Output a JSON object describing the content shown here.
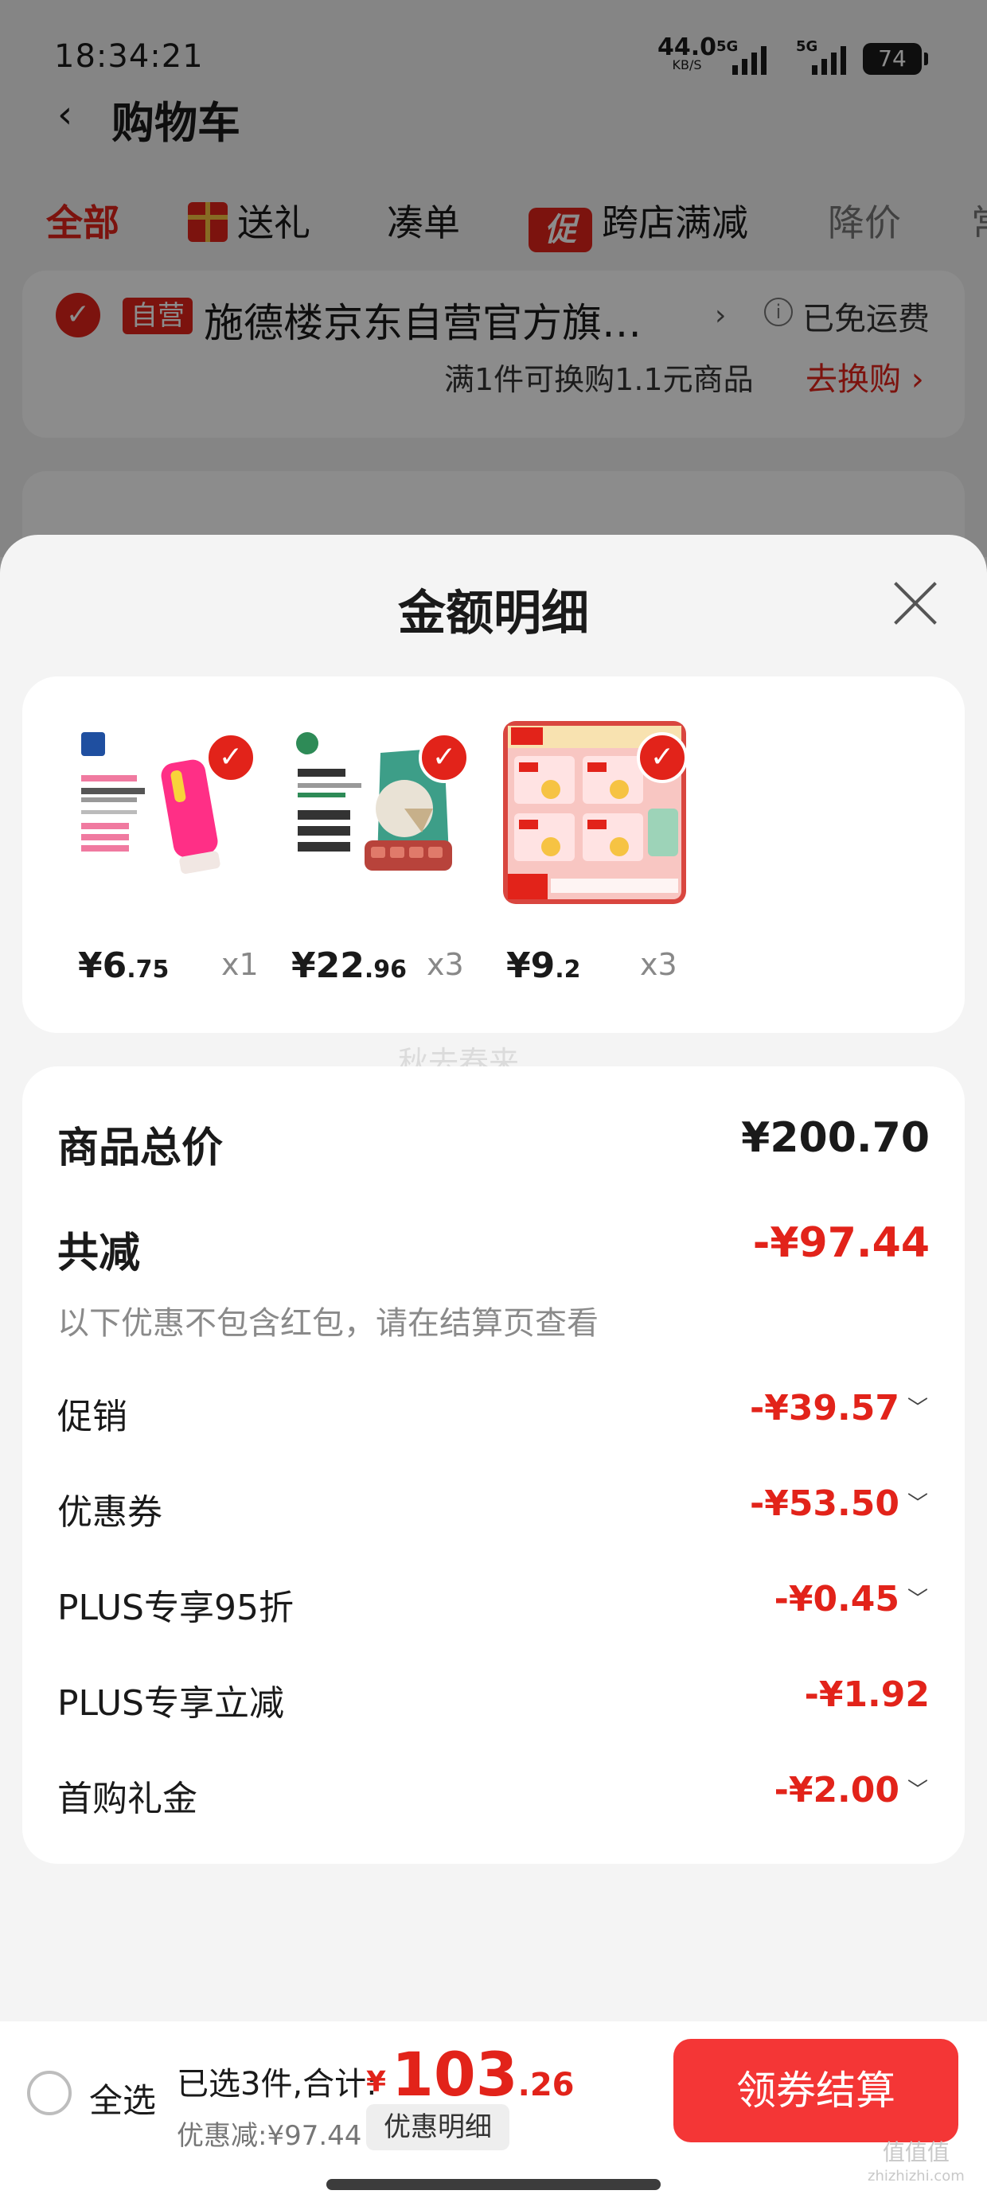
{
  "status_bar": {
    "time": "18:34:21",
    "net_speed": "44.0",
    "net_unit": "KB/S",
    "sig1_label": "5G",
    "sig2_label": "5G",
    "battery": "74"
  },
  "background": {
    "back_icon": "chevron-left-icon",
    "title": "购物车",
    "tabs": [
      {
        "label": "全部",
        "state": "active"
      },
      {
        "label": "送礼",
        "icon": "gift-icon"
      },
      {
        "label": "凑单"
      },
      {
        "label": "跨店满减",
        "badge": "促"
      },
      {
        "label": "降价",
        "state": "muted"
      },
      {
        "label": "常",
        "state": "muted"
      }
    ],
    "shop": {
      "badge": "自营",
      "name": "施德楼京东自营官方旗…",
      "arrow": "›",
      "info_icon": "i",
      "shipping": "已免运费",
      "swap_text": "满1件可换购1.1元商品",
      "swap_link": "去换购 ›"
    }
  },
  "sheet": {
    "title": "金额明细",
    "products": [
      {
        "price_main": "¥6",
        "price_dec": ".75",
        "qty": "x1",
        "thumb": "eraser-product-image"
      },
      {
        "price_main": "¥22",
        "price_dec": ".96",
        "qty": "x3",
        "thumb": "dog-treat-product-image"
      },
      {
        "price_main": "¥9",
        "price_dec": ".2",
        "qty": "x3",
        "thumb": "tissue-pack-product-image"
      }
    ],
    "watermark": "秋去春来",
    "total_label": "商品总价",
    "total_value": "¥200.70",
    "reduce_label": "共减",
    "reduce_value": "-¥97.44",
    "reduce_note": "以下优惠不包含红包，请在结算页查看",
    "items": [
      {
        "label": "促销",
        "value": "-¥39.57",
        "chev": "﹀"
      },
      {
        "label": "优惠券",
        "value": "-¥53.50",
        "chev": "﹀"
      },
      {
        "label": "PLUS专享95折",
        "value": "-¥0.45",
        "chev": "﹀"
      },
      {
        "label": "PLUS专享立减",
        "value": "-¥1.92",
        "chev": ""
      },
      {
        "label": "首购礼金",
        "value": "-¥2.00",
        "chev": "﹀"
      }
    ]
  },
  "footer": {
    "select_all": "全选",
    "summary": "已选3件,合计:",
    "currency": "¥",
    "amount_main": "103",
    "amount_dec": ".26",
    "discount": "优惠减:¥97.44",
    "detail_button": "优惠明细",
    "pay_button": "领券结算",
    "site_watermark": "值值值",
    "site_url": "zhizhizhi.com"
  },
  "colors": {
    "accent": "#e2231a",
    "pay_button": "#f43636"
  }
}
